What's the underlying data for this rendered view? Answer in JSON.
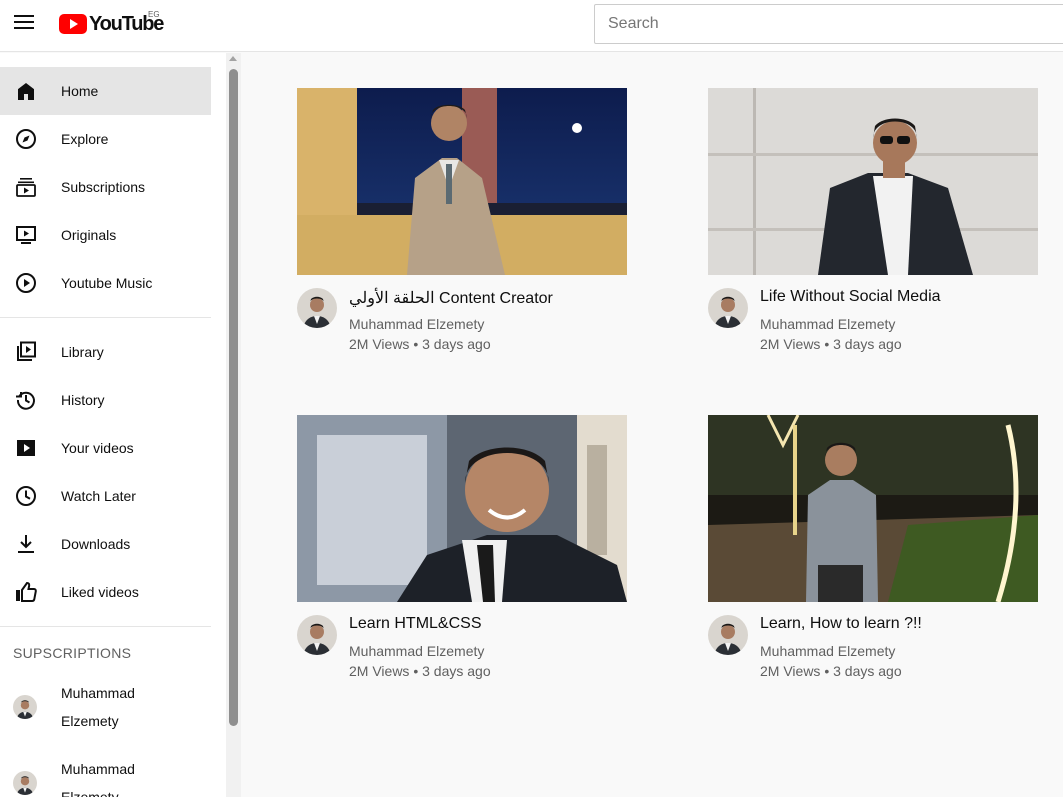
{
  "header": {
    "logo_text": "YouTube",
    "country_code": "EG",
    "search_placeholder": "Search"
  },
  "sidebar": {
    "primary": [
      {
        "label": "Home",
        "icon": "home-icon",
        "active": true
      },
      {
        "label": "Explore",
        "icon": "compass-icon"
      },
      {
        "label": "Subscriptions",
        "icon": "subscriptions-icon"
      },
      {
        "label": "Originals",
        "icon": "originals-icon"
      },
      {
        "label": "Youtube Music",
        "icon": "music-icon"
      }
    ],
    "secondary": [
      {
        "label": "Library",
        "icon": "library-icon"
      },
      {
        "label": "History",
        "icon": "history-icon"
      },
      {
        "label": "Your videos",
        "icon": "your-videos-icon"
      },
      {
        "label": "Watch Later",
        "icon": "clock-icon"
      },
      {
        "label": "Downloads",
        "icon": "download-icon"
      },
      {
        "label": "Liked videos",
        "icon": "thumbs-up-icon"
      }
    ],
    "subscriptions_heading": "SUPSCRIPTIONS",
    "subscriptions": [
      {
        "name": "Muhammad Elzemety"
      },
      {
        "name": "Muhammad Elzemety"
      }
    ]
  },
  "videos": [
    {
      "title": "الحلقة الأولي Content Creator",
      "channel": "Muhammad Elzemety",
      "meta": "2M Views • 3 days ago"
    },
    {
      "title": "Life Without Social Media",
      "channel": "Muhammad Elzemety",
      "meta": "2M Views • 3 days ago"
    },
    {
      "title": "Learn HTML&CSS",
      "channel": "Muhammad Elzemety",
      "meta": "2M Views • 3 days ago"
    },
    {
      "title": "Learn, How to learn ?!!",
      "channel": "Muhammad Elzemety",
      "meta": "2M Views • 3 days ago"
    }
  ],
  "colors": {
    "brand_red": "#ff0000",
    "sidebar_active": "#e5e5e5",
    "secondary_text": "#606060"
  }
}
